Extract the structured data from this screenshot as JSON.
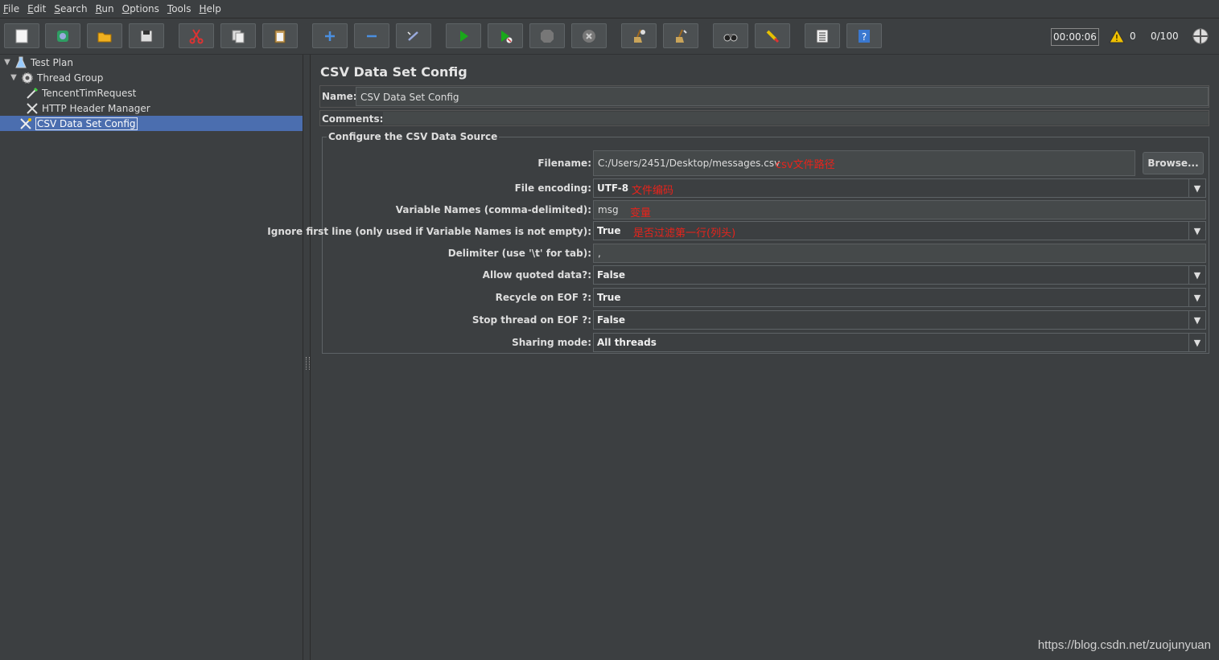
{
  "menu": [
    {
      "u": "F",
      "rest": "ile"
    },
    {
      "u": "E",
      "rest": "dit"
    },
    {
      "u": "S",
      "rest": "earch"
    },
    {
      "u": "R",
      "rest": "un"
    },
    {
      "u": "O",
      "rest": "ptions"
    },
    {
      "u": "T",
      "rest": "ools"
    },
    {
      "u": "H",
      "rest": "elp"
    }
  ],
  "status": {
    "timer": "00:00:06",
    "warnings": "0",
    "threads": "0/100"
  },
  "tree": {
    "test_plan": "Test Plan",
    "thread_group": "Thread Group",
    "request": "TencentTimRequest",
    "header_manager": "HTTP Header Manager",
    "csv_config": "CSV Data Set Config"
  },
  "panel": {
    "title": "CSV Data Set Config",
    "name_label": "Name:",
    "name_value": "CSV Data Set Config",
    "comments_label": "Comments:",
    "group_title": "Configure the CSV Data Source",
    "browse_label": "Browse..."
  },
  "fields": {
    "filename": {
      "label": "Filename:",
      "value": "C:/Users/2451/Desktop/messages.csv",
      "note": "csv文件路径"
    },
    "encoding": {
      "label": "File encoding:",
      "value": "UTF-8",
      "note": "文件编码"
    },
    "varnames": {
      "label": "Variable Names (comma-delimited):",
      "value": "msg",
      "note": "变量"
    },
    "ignore": {
      "label": "Ignore first line (only used if Variable Names is not empty):",
      "value": "True",
      "note": "是否过滤第一行(列头)"
    },
    "delimiter": {
      "label": "Delimiter (use '\\t' for tab):",
      "value": ","
    },
    "quoted": {
      "label": "Allow quoted data?:",
      "value": "False"
    },
    "recycle": {
      "label": "Recycle on EOF ?:",
      "value": "True"
    },
    "stop": {
      "label": "Stop thread on EOF ?:",
      "value": "False"
    },
    "sharing": {
      "label": "Sharing mode:",
      "value": "All threads"
    }
  },
  "watermark": "https://blog.csdn.net/zuojunyuan",
  "colors": {
    "background": "#3c3f41",
    "selection": "#4b6eaf",
    "annotation": "#e8231b"
  }
}
